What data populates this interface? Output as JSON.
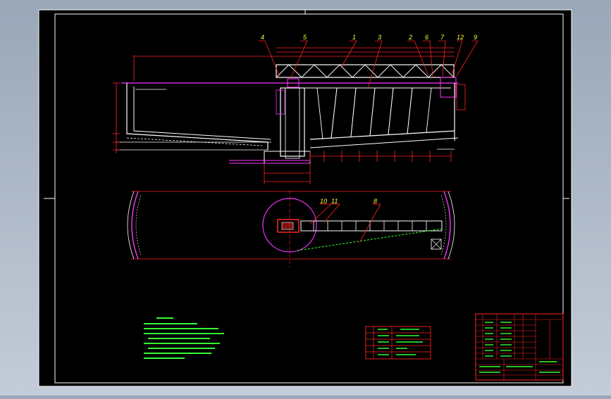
{
  "drawing": {
    "background": "#000000",
    "border_color": "#ffffff",
    "callouts": [
      "4",
      "5",
      "1",
      "3",
      "2",
      "6",
      "7",
      "12",
      "9"
    ],
    "plan_callouts": [
      "10",
      "11",
      "8"
    ]
  },
  "colors": {
    "structure": "#ffffff",
    "dimension": "#ff2222",
    "callout": "#ffff33",
    "outline": "#ff33ff",
    "annotation": "#33ff33",
    "leader": "#00ffff"
  },
  "table_small": {
    "rows": 4
  },
  "title_block": {
    "rows": 10
  }
}
